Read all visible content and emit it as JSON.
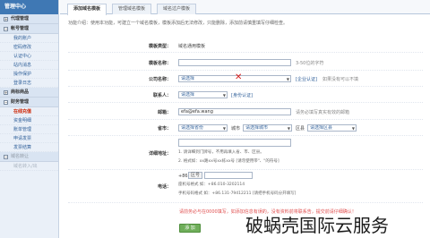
{
  "sidebar": {
    "title": "管理中心",
    "groups": [
      {
        "label": "代理管理",
        "items": []
      },
      {
        "label": "帐号管理",
        "items": [
          "我的账户",
          "密码修改",
          "认证中心",
          "站内消息",
          "操作保护",
          "登录日志"
        ]
      },
      {
        "label": "商标商品",
        "items": []
      },
      {
        "label": "财务管理",
        "items": [
          "在线充值",
          "资金明细",
          "账单管理",
          "申请发票",
          "发票结算"
        ]
      },
      {
        "label": "域名转让",
        "items": [
          "域名转入/出"
        ]
      }
    ]
  },
  "tabs": [
    "添加域名模板",
    "管理域名模板",
    "域名过户模板"
  ],
  "intro": "功能介绍：使用本功能，可建立一个域名模板，模板添加后无法修改，只能删除，添加前请慎重填写仔细检查。",
  "form": {
    "template_type_label": "模板类型：",
    "template_type_value": "域名通用模板",
    "template_name_label": "模板名称：",
    "template_name_hint": "3-50位的字符",
    "company_label": "公司名称：",
    "company_placeholder": "请选择",
    "company_link": "[企业认证]",
    "company_hint": "如果没有可以不填",
    "contact_label": "联系人：",
    "contact_placeholder": "请选择",
    "contact_link": "[身份认证]",
    "email_label": "邮箱：",
    "email_value": "efa@efa.wang",
    "email_hint": "请务必填写真实有效的邮箱",
    "region_label": "省市：",
    "province_placeholder": "请选择省份",
    "city_label": "城市",
    "city_placeholder": "请选择城市",
    "district_label": "区县",
    "district_placeholder": "请选择区县",
    "address_label": "详细地址：",
    "address_note1": "1. 请详细到门牌号，不用再填入省、市、区县。",
    "address_note2": "2. 格式如：xx路xx号xx栋xx号 [请勿使用带\"、\"的符号]",
    "phone_label": "电话：",
    "phone_prefix": "+86",
    "phone_prefix_option": "区号",
    "phone_note1": "座机号格式 如：+86.010-3202114",
    "phone_note2": "手机号码格式 如：+86.131-79412211 [请把手机号码分开填写]",
    "notice": "请前务必与在0000填写，如添加信息有误的，没有资料前将联系告，提交前请仔细确认！",
    "submit_label": "添 加"
  },
  "watermark": "破蜗壳国际云服务"
}
